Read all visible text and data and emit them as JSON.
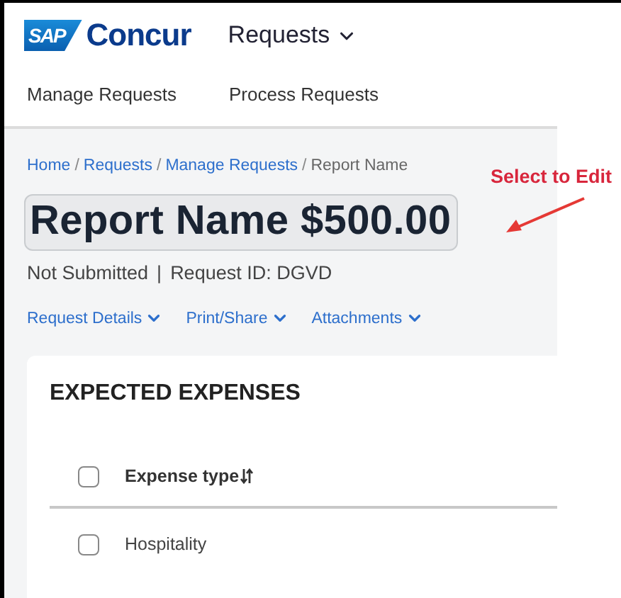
{
  "header": {
    "logo": {
      "mark": "SAP",
      "name": "Concur"
    },
    "menu": {
      "label": "Requests"
    }
  },
  "subnav": [
    {
      "label": "Manage Requests"
    },
    {
      "label": "Process Requests"
    }
  ],
  "breadcrumb": [
    {
      "kind": "link",
      "label": "Home"
    },
    {
      "kind": "separator",
      "label": "/"
    },
    {
      "kind": "link",
      "label": "Requests"
    },
    {
      "kind": "separator",
      "label": "/"
    },
    {
      "kind": "link",
      "label": "Manage Requests"
    },
    {
      "kind": "separator",
      "label": "/"
    },
    {
      "kind": "current",
      "label": "Report Name"
    }
  ],
  "title": "Report Name $500.00",
  "status": {
    "state": "Not Submitted",
    "separator": "|",
    "request_id": "Request ID: DGVD"
  },
  "actions": [
    {
      "label": "Request Details"
    },
    {
      "label": "Print/Share"
    },
    {
      "label": "Attachments"
    }
  ],
  "card": {
    "title": "EXPECTED EXPENSES",
    "columns": [
      {
        "label": "Expense type",
        "sortable": true
      }
    ],
    "header_checked": false,
    "rows": [
      {
        "expense_type": "Hospitality",
        "checked": false
      }
    ]
  },
  "annotation": {
    "text": "Select to Edit"
  }
}
